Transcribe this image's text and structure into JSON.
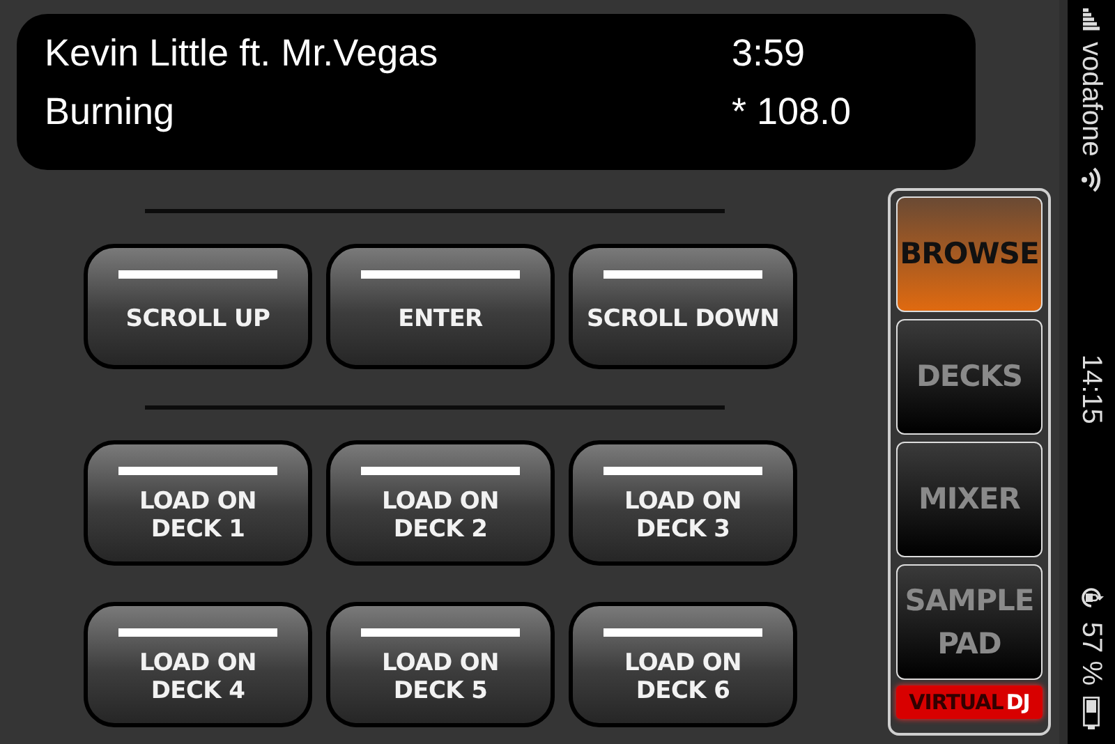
{
  "now_playing": {
    "artist": "Kevin Little ft. Mr.Vegas",
    "length": "3:59",
    "title": "Burning",
    "bpm": "* 108.0"
  },
  "sections": [
    {
      "buttons": [
        {
          "label": "SCROLL UP"
        },
        {
          "label": "ENTER"
        },
        {
          "label": "SCROLL DOWN"
        }
      ]
    },
    {
      "buttons": [
        {
          "label": "LOAD ON\nDECK 1"
        },
        {
          "label": "LOAD ON\nDECK 2"
        },
        {
          "label": "LOAD ON\nDECK 3"
        },
        {
          "label": "LOAD ON\nDECK 4"
        },
        {
          "label": "LOAD ON\nDECK 5"
        },
        {
          "label": "LOAD ON\nDECK 6"
        }
      ]
    }
  ],
  "tabs": [
    {
      "label": "BROWSE",
      "selected": true
    },
    {
      "label": "DECKS",
      "selected": false
    },
    {
      "label": "MIXER",
      "selected": false
    },
    {
      "label": "SAMPLE\nPAD",
      "selected": false
    }
  ],
  "logo": {
    "part_1": "VIRTUAL",
    "part_2": "DJ"
  },
  "status_bar": {
    "carrier": "vodafone",
    "time": "14:15",
    "battery": "57 %"
  }
}
